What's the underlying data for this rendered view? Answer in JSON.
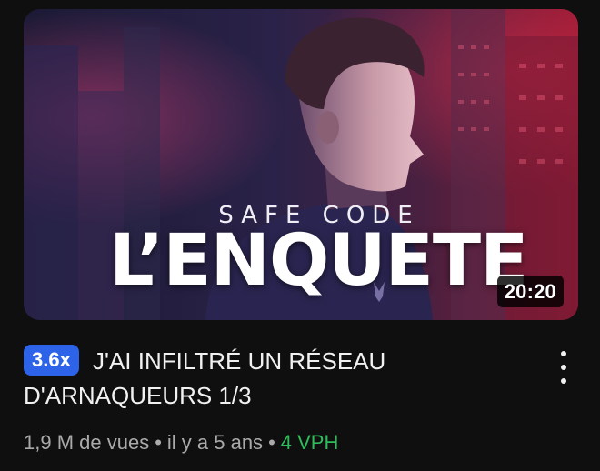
{
  "thumbnail": {
    "overlay_subtitle": "SAFE CODE",
    "overlay_title": "L’ENQUETE",
    "duration": "20:20"
  },
  "video": {
    "multiplier_badge": "3.6x",
    "title": "J'AI INFILTRÉ UN RÉSEAU D'ARNAQUEURS 1/3"
  },
  "meta": {
    "views": "1,9 M de vues",
    "separator": "•",
    "age": "il y a 5 ans",
    "vph": "4 VPH"
  },
  "icons": {
    "more": "more-vert-icon"
  },
  "colors": {
    "background": "#0f0f0f",
    "badge": "#2d63e8",
    "vph": "#2dbd5a",
    "meta_text": "#aaaaaa"
  }
}
